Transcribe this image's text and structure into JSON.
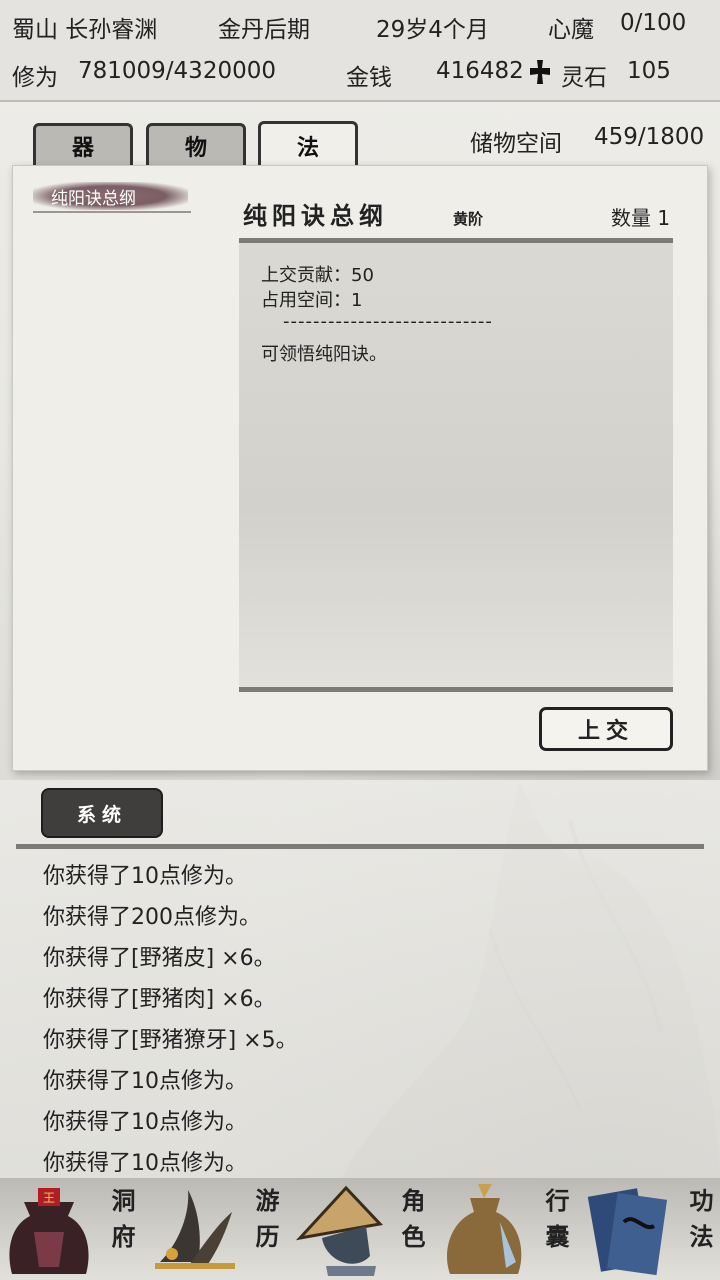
{
  "status": {
    "sect_name": "蜀山 长孙睿渊",
    "realm": "金丹后期",
    "age": "29岁4个月",
    "heart_demon_label": "心魔",
    "heart_demon_value": "0/100",
    "cultivation_label": "修为",
    "cultivation_value": "781009/4320000",
    "money_label": "金钱",
    "money_value": "416482",
    "spirit_stone_label": "灵石",
    "spirit_stone_value": "105",
    "money_icon": "cross-icon"
  },
  "storage": {
    "label": "储物空间",
    "value": "459/1800"
  },
  "tabs": [
    {
      "label": "器",
      "active": false
    },
    {
      "label": "物",
      "active": false
    },
    {
      "label": "法",
      "active": true
    }
  ],
  "item_list": [
    {
      "name": "纯阳诀总纲",
      "selected": true
    }
  ],
  "detail": {
    "title": "纯阳诀总纲",
    "grade": "黄阶",
    "quantity": "数量 1",
    "contribution": "上交贡献：50",
    "space": "占用空间：1",
    "separator": "----------------------------",
    "description": "可领悟纯阳诀。",
    "submit_label": "上交"
  },
  "log": {
    "tab_label": "系统",
    "messages": [
      "你获得了10点修为。",
      "你获得了200点修为。",
      "你获得了[野猪皮] ×6。",
      "你获得了[野猪肉] ×6。",
      "你获得了[野猪獠牙] ×5。",
      "你获得了10点修为。",
      "你获得了10点修为。",
      "你获得了10点修为。"
    ]
  },
  "nav": [
    {
      "label": "洞府",
      "icon": "cave-bag-icon"
    },
    {
      "label": "游历",
      "icon": "grass-icon"
    },
    {
      "label": "角色",
      "icon": "straw-hat-icon"
    },
    {
      "label": "行囊",
      "icon": "bundle-bag-icon"
    },
    {
      "label": "功法",
      "icon": "books-icon"
    }
  ],
  "colors": {
    "tab_active": "#f0efea",
    "tab_inactive": "#bbb9b3",
    "selected_item": "#7a5e64",
    "log_tab": "#3f3e3c"
  }
}
